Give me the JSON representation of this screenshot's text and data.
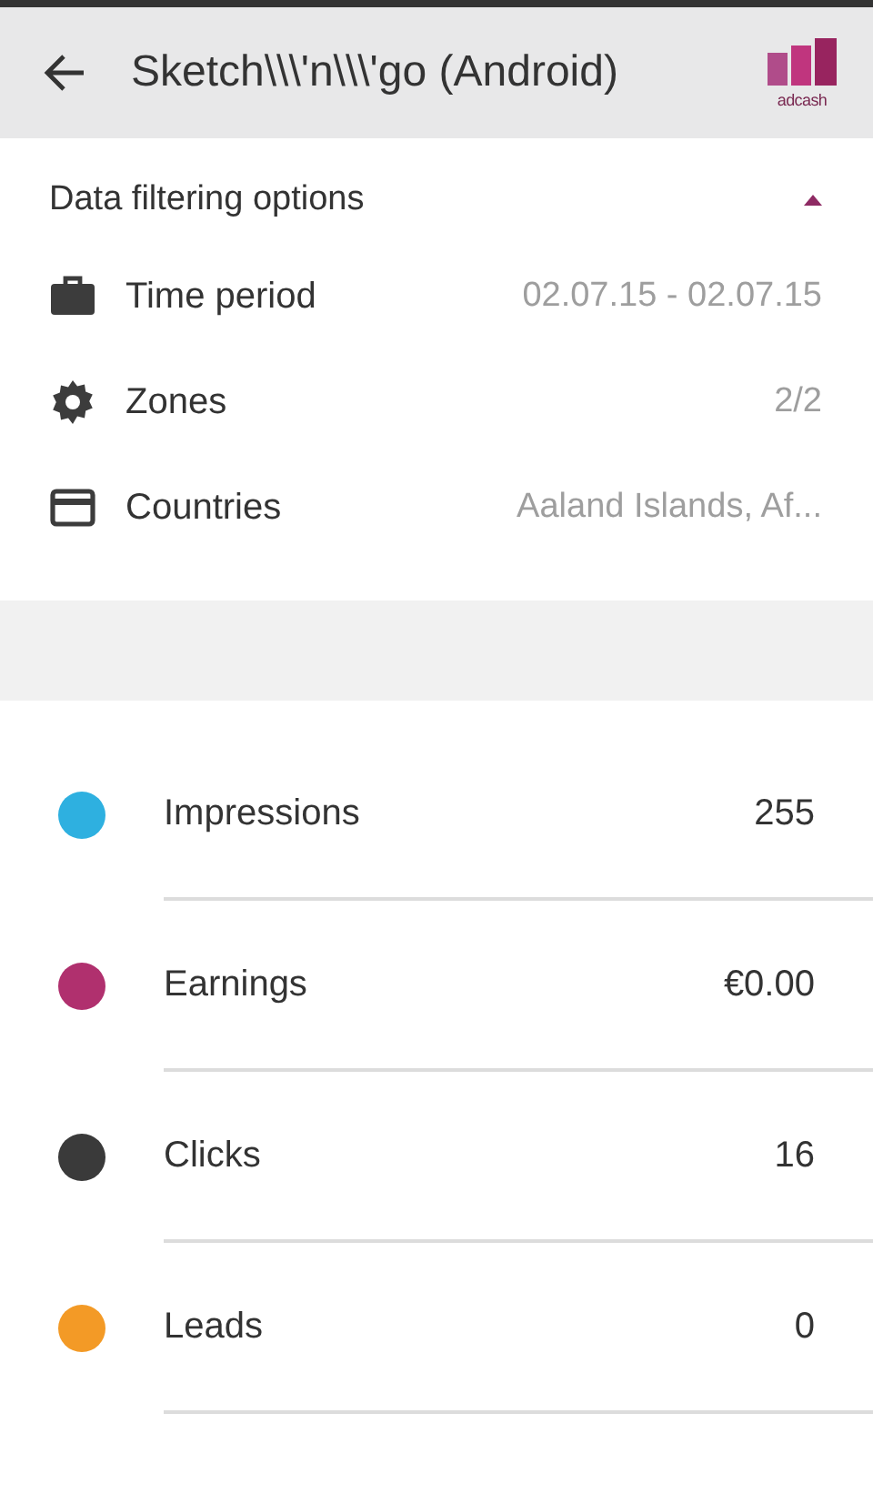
{
  "app_bar": {
    "title": "Sketch\\\\\\'n\\\\\\'go (Android)",
    "logo_text": "adcash"
  },
  "filters": {
    "title": "Data filtering options",
    "expanded": true,
    "items": [
      {
        "kind": "briefcase",
        "label": "Time period",
        "value": "02.07.15 - 02.07.15"
      },
      {
        "kind": "gear",
        "label": "Zones",
        "value": "2/2"
      },
      {
        "kind": "card",
        "label": "Countries",
        "value": "Aaland Islands, Af..."
      }
    ]
  },
  "stats": [
    {
      "label": "Impressions",
      "value": "255",
      "color": "#2eb0e0"
    },
    {
      "label": "Earnings",
      "value": "€0.00",
      "color": "#b0306e"
    },
    {
      "label": "Clicks",
      "value": "16",
      "color": "#3a3a3a"
    },
    {
      "label": "Leads",
      "value": "0",
      "color": "#f39a26"
    }
  ]
}
